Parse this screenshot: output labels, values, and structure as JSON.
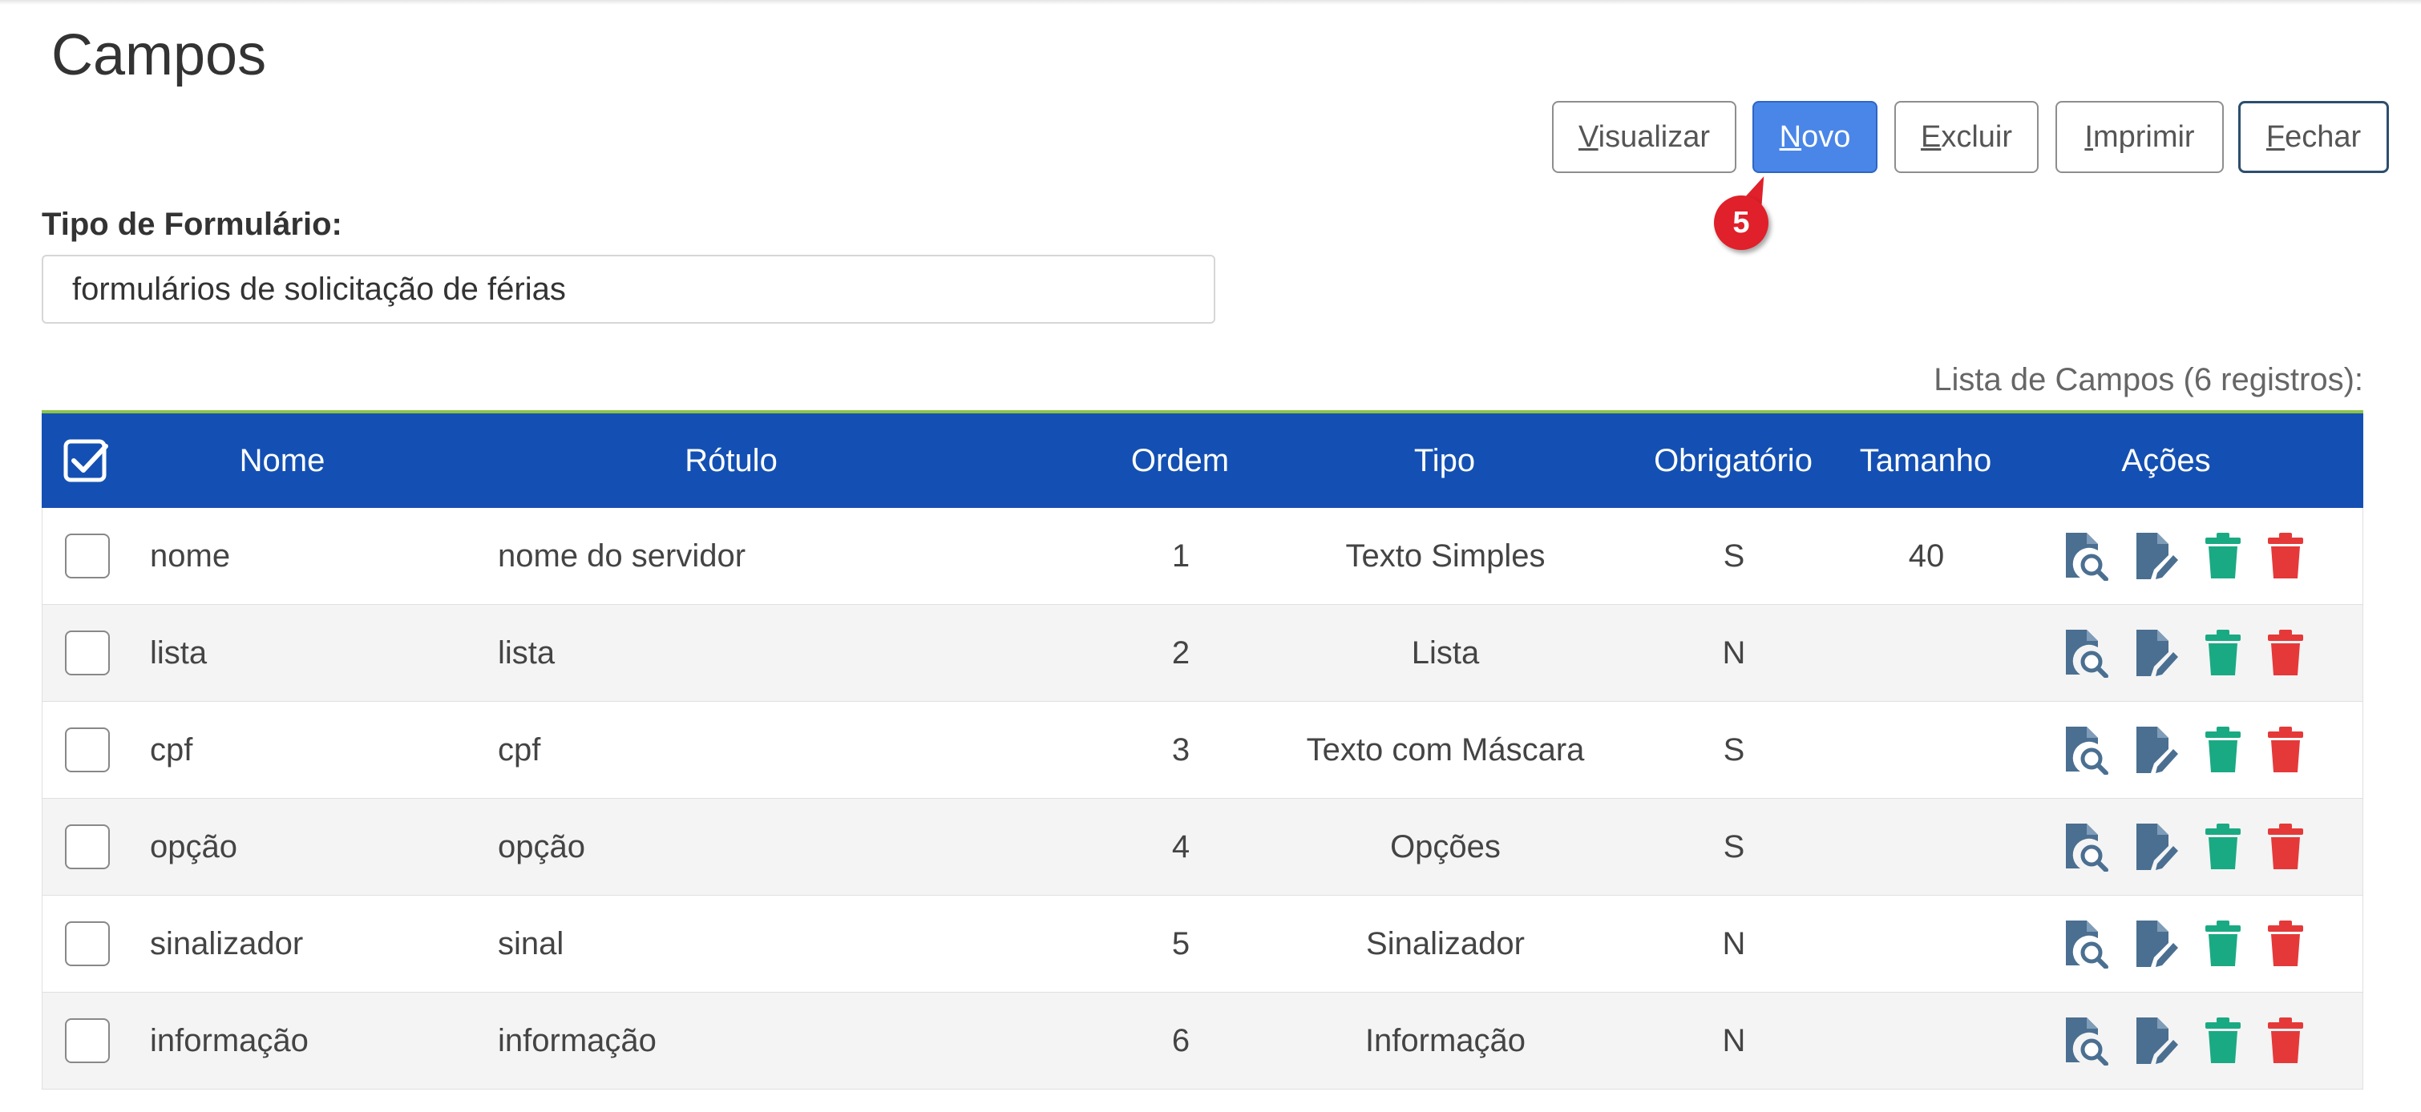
{
  "page": {
    "title": "Campos"
  },
  "toolbar": {
    "visualizar": "Visualizar",
    "novo": "Novo",
    "excluir": "Excluir",
    "imprimir": "Imprimir",
    "fechar": "Fechar"
  },
  "callout": {
    "number": "5"
  },
  "form": {
    "tipo_label": "Tipo de Formulário:",
    "tipo_value": "formulários de solicitação de férias"
  },
  "list": {
    "count_label": "Lista de Campos (6 registros):"
  },
  "table": {
    "headers": {
      "nome": "Nome",
      "rotulo": "Rótulo",
      "ordem": "Ordem",
      "tipo": "Tipo",
      "obrigatorio": "Obrigatório",
      "tamanho": "Tamanho",
      "acoes": "Ações"
    },
    "rows": [
      {
        "nome": "nome",
        "rotulo": "nome do servidor",
        "ordem": "1",
        "tipo": "Texto Simples",
        "obrigatorio": "S",
        "tamanho": "40"
      },
      {
        "nome": "lista",
        "rotulo": "lista",
        "ordem": "2",
        "tipo": "Lista",
        "obrigatorio": "N",
        "tamanho": ""
      },
      {
        "nome": "cpf",
        "rotulo": "cpf",
        "ordem": "3",
        "tipo": "Texto com Máscara",
        "obrigatorio": "S",
        "tamanho": ""
      },
      {
        "nome": "opção",
        "rotulo": "opção",
        "ordem": "4",
        "tipo": "Opções",
        "obrigatorio": "S",
        "tamanho": ""
      },
      {
        "nome": "sinalizador",
        "rotulo": "sinal",
        "ordem": "5",
        "tipo": "Sinalizador",
        "obrigatorio": "N",
        "tamanho": ""
      },
      {
        "nome": "informação",
        "rotulo": "informação",
        "ordem": "6",
        "tipo": "Informação",
        "obrigatorio": "N",
        "tamanho": ""
      }
    ]
  },
  "icons": {
    "header_select": "checkbox-checked-icon",
    "view": "file-search-icon",
    "edit": "file-edit-icon",
    "trash_green": "trash-icon",
    "trash_red": "trash-icon"
  },
  "colors": {
    "header_bg": "#1450b3",
    "header_top_line": "#8bc34a",
    "primary_button": "#4a86e8",
    "badge": "#e0202a",
    "view_icon": "#4a6f91",
    "edit_icon": "#4a6f91",
    "trash_green": "#1aaa83",
    "trash_red": "#e53939"
  }
}
